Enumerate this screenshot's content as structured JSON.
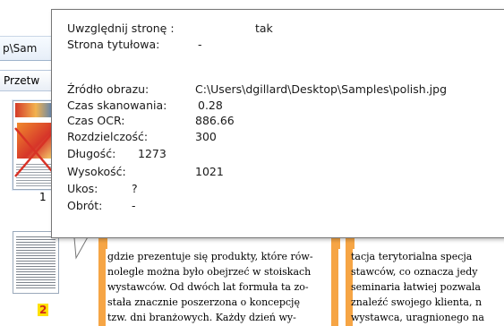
{
  "background": {
    "path_text": "p\\Sam",
    "tab_text": "Przetw",
    "thumbnails": [
      {
        "number": "1"
      },
      {
        "number": "2"
      }
    ]
  },
  "document": {
    "left_column_lines": [
      "gdzie prezentuje się produkty, które rów-",
      "nolegle można było obejrzeć w stoiskach",
      "wystawców. Od dwóch lat formuła ta zo-",
      "stała znacznie poszerzona o koncepcję",
      "tzw. dni branżowych. Każdy dzień wy-"
    ],
    "right_column_lines": [
      "tacja terytorialna specja",
      "stawców, co oznacza jedy",
      "seminaria łatwiej pozwala",
      "znaleźć swojego klienta, n",
      "wystawca, uragnionego na"
    ],
    "highlight_color": "#f6a545"
  },
  "tooltip": {
    "rows": [
      {
        "label": "Uwzględnij stronę :",
        "value": "tak"
      },
      {
        "label": "Strona tytułowa:",
        "value": "-"
      },
      {
        "label": "Źródło obrazu:",
        "value": "C:\\Users\\dgillard\\Desktop\\Samples\\polish.jpg"
      },
      {
        "label": "Czas skanowania:",
        "value": "0.28"
      },
      {
        "label": "Czas OCR:",
        "value": "886.66"
      },
      {
        "label": "Rozdzielczość:",
        "value": "300"
      },
      {
        "label": "Długość:",
        "value": "1273"
      },
      {
        "label": "Wysokość:",
        "value": "1021"
      },
      {
        "label": "Ukos:",
        "value": "?"
      },
      {
        "label": "Obrót:",
        "value": "-"
      }
    ]
  }
}
